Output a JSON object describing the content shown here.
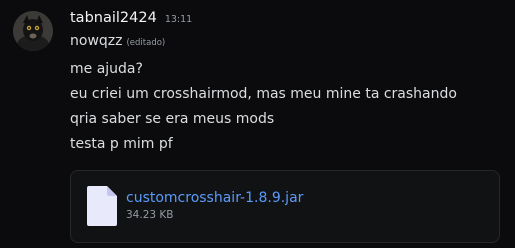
{
  "message": {
    "author": {
      "username": "tabnail2424",
      "timestamp": "13:11"
    },
    "edited_label": "(editado)",
    "lines": [
      "nowqzz",
      "me ajuda?",
      "eu criei um crosshairmod, mas meu mine ta crashando",
      "qria saber se era meus mods",
      "testa p mim pf"
    ],
    "attachment": {
      "icon": "file-icon",
      "file_name": "customcrosshair-1.8.9.jar",
      "file_size": "34.23 KB"
    }
  },
  "colors": {
    "background": "#0b0b0d",
    "text": "#dbdee1",
    "muted": "#949ba4",
    "link": "#5b9bf8",
    "attachment_bg": "#111214"
  }
}
